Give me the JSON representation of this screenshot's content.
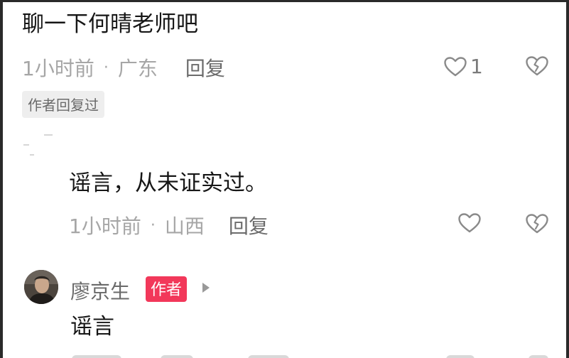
{
  "comments": {
    "c1": {
      "text": "聊一下何晴老师吧",
      "time": "1小时前",
      "separator": "·",
      "location": "广东",
      "reply_label": "回复",
      "likes": "1",
      "author_replied_tag": "作者回复过"
    },
    "c2": {
      "text": "谣言，从未证实过。",
      "time": "1小时前",
      "separator": "·",
      "location": "山西",
      "reply_label": "回复"
    },
    "c3": {
      "username": "廖京生",
      "author_badge": "作者",
      "text": "谣言"
    }
  },
  "icons": {
    "like": "heart-outline-icon",
    "dislike": "broken-heart-icon",
    "expand": "triangle-right-icon"
  },
  "colors": {
    "text_primary": "#161616",
    "meta_gray": "#a6a6a6",
    "reply_gray": "#6b6b6b",
    "tag_bg": "#eeeeee",
    "author_badge": "#f2385a"
  }
}
